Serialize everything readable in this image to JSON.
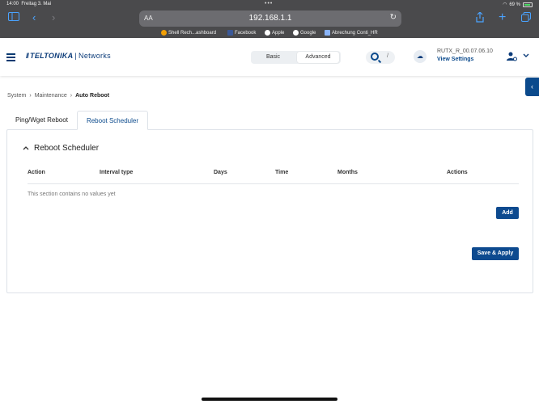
{
  "status_bar": {
    "time": "14:00",
    "date": "Freitag 3. Mai",
    "battery": "69 %"
  },
  "browser": {
    "text_size_label": "AA",
    "url": "192.168.1.1",
    "bookmarks": [
      {
        "label": "Shell Rech...ashboard",
        "color": "#f2a007"
      },
      {
        "label": "Facebook",
        "color": "#3b5998"
      },
      {
        "label": "Apple",
        "color": "#ffffff"
      },
      {
        "label": "Google",
        "color": "#ffffff"
      },
      {
        "label": "Abrechung Conti_HR",
        "color": "#8ab4f8"
      }
    ]
  },
  "header": {
    "brand": "TELTONIKA",
    "brand_suffix": "Networks",
    "mode_basic": "Basic",
    "mode_advanced": "Advanced",
    "search_shortcut": "/",
    "firmware": "RUTX_R_00.07.06.10",
    "view_settings": "View Settings"
  },
  "breadcrumb": [
    "System",
    "Maintenance",
    "Auto Reboot"
  ],
  "tabs": [
    "Ping/Wget Reboot",
    "Reboot Scheduler"
  ],
  "section": {
    "title": "Reboot Scheduler",
    "columns": [
      "Action",
      "Interval type",
      "Days",
      "Time",
      "Months",
      "Actions"
    ],
    "empty_message": "This section contains no values yet",
    "add_label": "Add",
    "save_label": "Save & Apply"
  },
  "colors": {
    "accent": "#0d4a8f",
    "brand": "#0c3c7a",
    "browser_chrome": "#4a4a4c"
  }
}
